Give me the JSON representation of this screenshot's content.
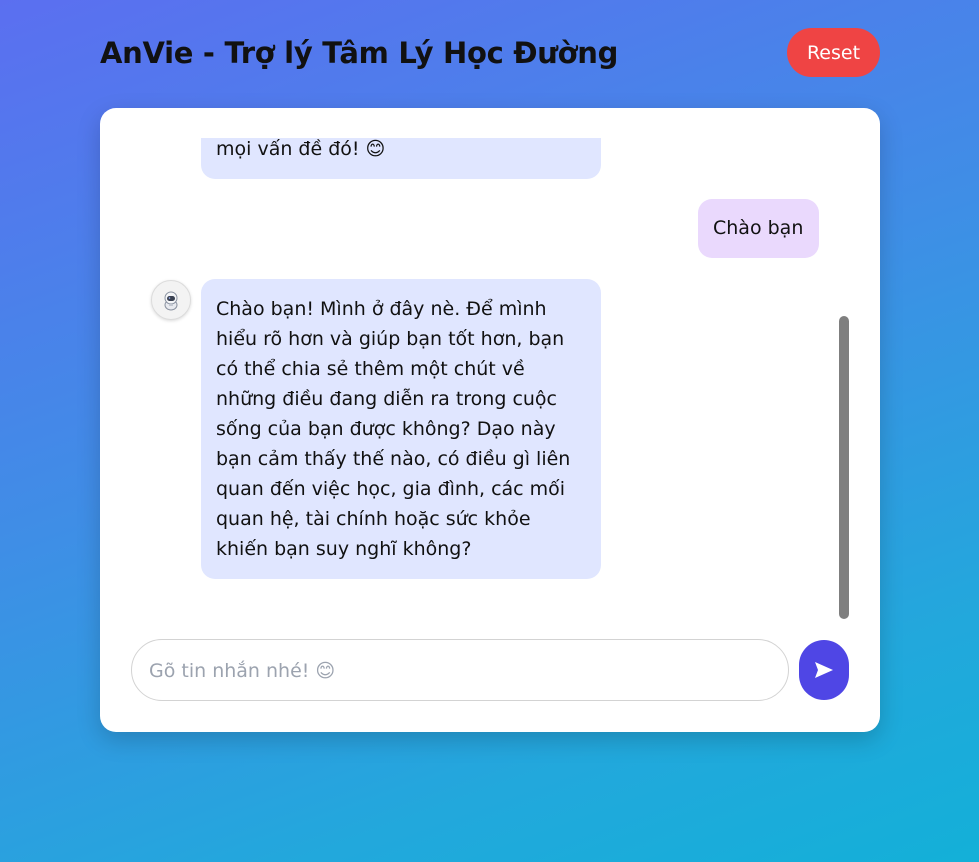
{
  "app": {
    "title": "AnVie - Trợ lý Tâm Lý Học Đường",
    "reset_label": "Reset"
  },
  "chat": {
    "messages": [
      {
        "role": "bot",
        "text": "mọi vấn đề đó! 😊"
      },
      {
        "role": "user",
        "text": "Chào bạn"
      },
      {
        "role": "bot",
        "text": "Chào bạn! Mình ở đây nè. Để mình hiểu rõ hơn và giúp bạn tốt hơn, bạn có thể chia sẻ thêm một chút về những điều đang diễn ra trong cuộc sống của bạn được không? Dạo này bạn cảm thấy thế nào, có điều gì liên quan đến việc học, gia đình, các mối quan hệ, tài chính hoặc sức khỏe khiến bạn suy nghĩ không?"
      }
    ],
    "bot_avatar_icon": "astronaut-icon"
  },
  "composer": {
    "placeholder": "Gõ tin nhắn nhé! 😊",
    "value": "",
    "send_icon": "send-icon"
  },
  "colors": {
    "reset_button": "#ef4444",
    "send_button": "#4f46e5",
    "bot_bubble": "#e0e6ff",
    "user_bubble": "#ead9fd"
  }
}
